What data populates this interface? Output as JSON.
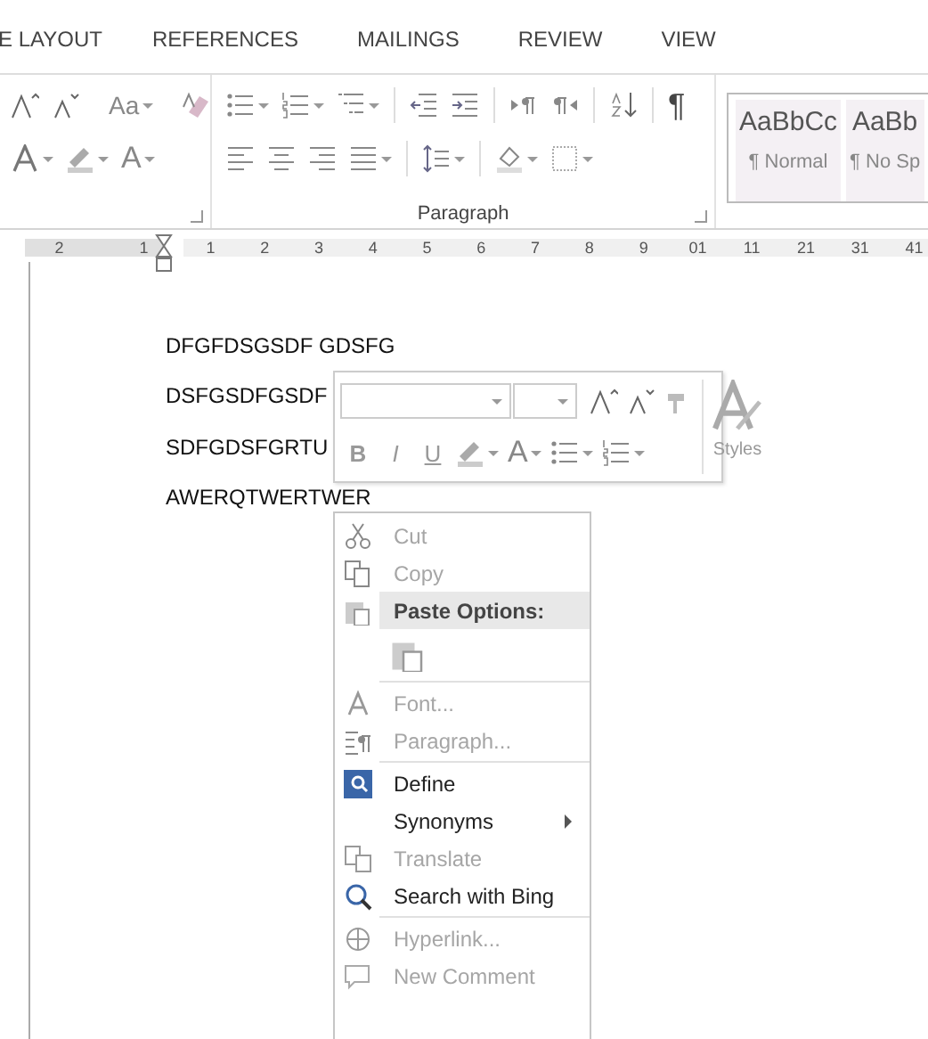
{
  "tabs": [
    {
      "label": "E LAYOUT",
      "selected": false
    },
    {
      "label": "REFERENCES",
      "selected": false
    },
    {
      "label": "MAILINGS",
      "selected": false
    },
    {
      "label": "REVIEW",
      "selected": false
    },
    {
      "label": "VIEW",
      "selected": false
    }
  ],
  "ribbon": {
    "change_case": "Aa",
    "font_color": "A",
    "show_marks": "¶",
    "paragraph_group": "Paragraph",
    "styles": [
      {
        "preview": "AaBbCc",
        "name": "¶ Normal",
        "selected": false
      },
      {
        "preview": "AaBb",
        "name": "¶ No Sp",
        "selected": false
      }
    ]
  },
  "ruler": {
    "left_labels": [
      "2",
      "1"
    ],
    "right_labels": [
      "1",
      "2",
      "3",
      "4",
      "5",
      "6",
      "7",
      "8",
      "9",
      "01",
      "11",
      "21",
      "31",
      "41"
    ]
  },
  "document": {
    "lines": [
      "DFGFDSGSDF GDSFG",
      "DSFGSDFGSDF",
      "SDFGDSFGRTU",
      "AWERQTWERTWER"
    ]
  },
  "mini_toolbar": {
    "format_buttons": [
      "B",
      "I",
      "U"
    ],
    "font_color": "A",
    "styles_label": "Styles"
  },
  "context_menu": [
    {
      "kind": "item",
      "label": "Cut",
      "disabled": true
    },
    {
      "kind": "item",
      "label": "Copy",
      "disabled": true
    },
    {
      "kind": "header",
      "label": "Paste Options:"
    },
    {
      "kind": "paste"
    },
    {
      "kind": "separator"
    },
    {
      "kind": "item",
      "label": "Font...",
      "disabled": true
    },
    {
      "kind": "item",
      "label": "Paragraph...",
      "disabled": true
    },
    {
      "kind": "separator"
    },
    {
      "kind": "item",
      "label": "Define",
      "disabled": false
    },
    {
      "kind": "item",
      "label": "Synonyms",
      "disabled": false,
      "submenu": true
    },
    {
      "kind": "item",
      "label": "Translate",
      "disabled": true
    },
    {
      "kind": "item",
      "label": "Search with Bing",
      "disabled": false
    },
    {
      "kind": "separator"
    },
    {
      "kind": "item",
      "label": "Hyperlink...",
      "disabled": true
    },
    {
      "kind": "item",
      "label": "New Comment",
      "disabled": true
    }
  ]
}
